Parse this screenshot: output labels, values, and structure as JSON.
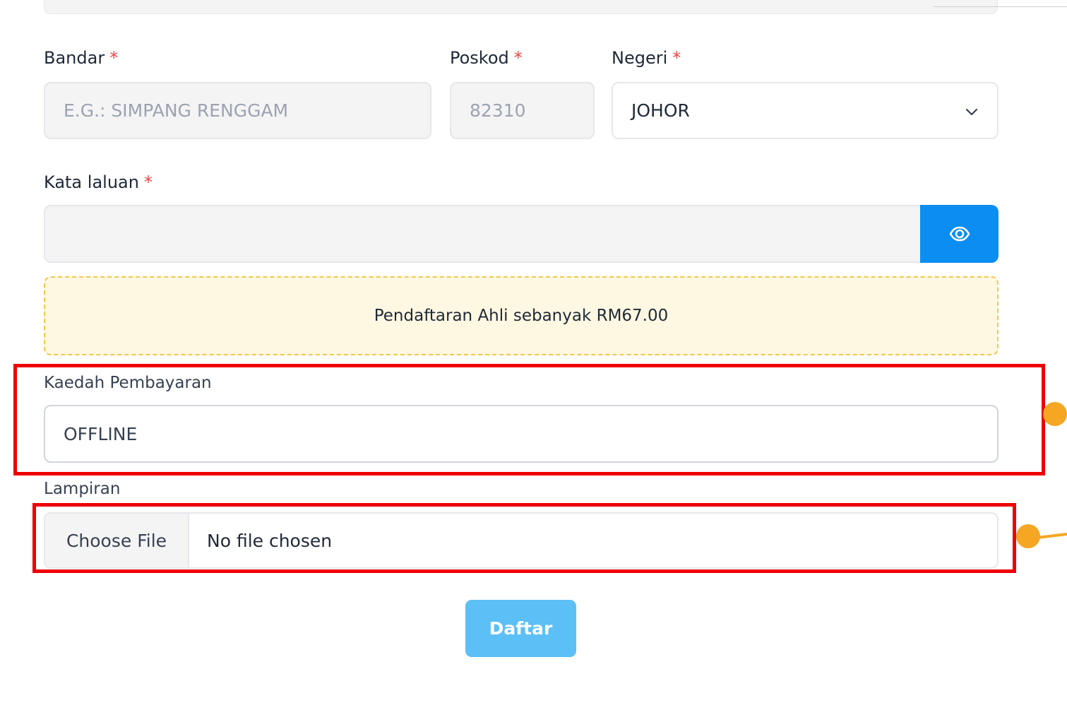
{
  "form": {
    "city": {
      "label": "Bandar",
      "required": "*",
      "placeholder": "E.G.: SIMPANG RENGGAM"
    },
    "postcode": {
      "label": "Poskod",
      "required": "*",
      "value": "82310"
    },
    "state": {
      "label": "Negeri",
      "required": "*",
      "selected": "JOHOR",
      "icon": "chevron-down-icon"
    },
    "password": {
      "label": "Kata laluan",
      "required": "*",
      "value": "",
      "toggle_icon": "eye-icon"
    },
    "notice": {
      "text": "Pendaftaran Ahli sebanyak RM67.00"
    },
    "payment_method": {
      "label": "Kaedah Pembayaran",
      "value": "OFFLINE"
    },
    "attachment": {
      "label": "Lampiran",
      "button_label": "Choose File",
      "status": "No file chosen"
    },
    "submit": {
      "label": "Daftar"
    }
  },
  "colors": {
    "primary": "#0b8df2",
    "submit": "#5cbff6",
    "required": "#ef4444",
    "notice_bg": "#fef8e2",
    "notice_border": "#f5c64a",
    "highlight": "#ef0000",
    "annotation_dot": "#f5a623"
  }
}
